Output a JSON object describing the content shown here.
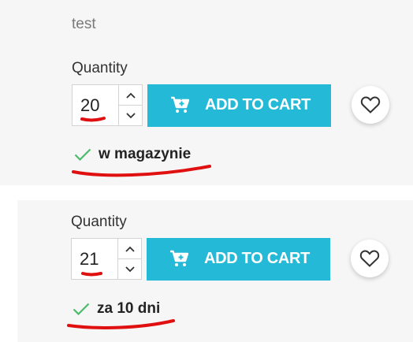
{
  "product_1": {
    "description": "test",
    "quantity_label": "Quantity",
    "quantity_value": "20",
    "add_to_cart_label": "ADD TO CART",
    "availability": "w magazynie"
  },
  "product_2": {
    "quantity_label": "Quantity",
    "quantity_value": "21",
    "add_to_cart_label": "ADD TO CART",
    "availability": "za 10 dni"
  },
  "colors": {
    "accent": "#24b9d7",
    "check": "#4cbb6c",
    "annotation": "#e01010",
    "panel": "#f6f6f6"
  },
  "icons": [
    "cart-icon",
    "heart-icon",
    "check-icon",
    "chevron-up-icon",
    "chevron-down-icon"
  ]
}
